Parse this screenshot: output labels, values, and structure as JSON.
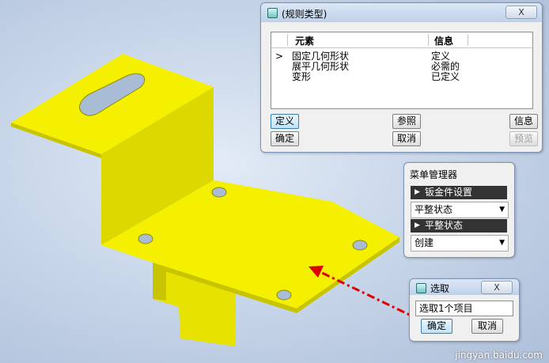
{
  "colors": {
    "part_face": "#f5f000",
    "part_shadow": "#cfcb00",
    "arrow": "#dd0000"
  },
  "rule_dialog": {
    "title": "(规则类型)",
    "close_label": "X",
    "columns": [
      "元素",
      "信息"
    ],
    "selection_marker": ">",
    "rows": [
      {
        "element": "固定几何形状",
        "info": "定义"
      },
      {
        "element": "展平几何形状",
        "info": "必需的"
      },
      {
        "element": "变形",
        "info": "已定义"
      }
    ],
    "buttons": {
      "define": "定义",
      "reference": "参照",
      "info": "信息",
      "ok": "确定",
      "cancel": "取消",
      "preview": "预览"
    }
  },
  "menu_manager": {
    "title": "菜单管理器",
    "section1": "钣金件设置",
    "select1": "平整状态",
    "section2": "平整状态",
    "select2": "创建"
  },
  "select_dialog": {
    "title": "选取",
    "close_label": "X",
    "prompt": "选取1个项目",
    "ok": "确定",
    "cancel": "取消"
  },
  "watermark": "jingyan.baidu.com"
}
